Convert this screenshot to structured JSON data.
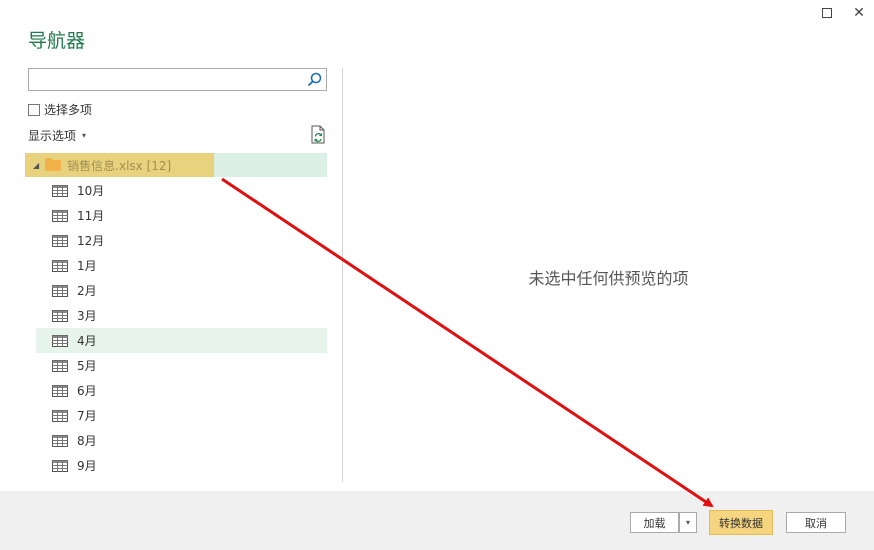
{
  "dialog": {
    "title": "导航器",
    "window_controls": {
      "maximize_icon": "square-icon",
      "close_glyph": "✕"
    }
  },
  "search": {
    "value": "",
    "placeholder": ""
  },
  "options": {
    "multi_select_label": "选择多项",
    "multi_select_checked": false,
    "display_options_label": "显示选项",
    "display_options_caret": "▾"
  },
  "tree": {
    "root": {
      "label": "销售信息.xlsx [12]",
      "expanded_glyph": "◢"
    },
    "items": [
      {
        "label": "10月",
        "selected": false
      },
      {
        "label": "11月",
        "selected": false
      },
      {
        "label": "12月",
        "selected": false
      },
      {
        "label": "1月",
        "selected": false
      },
      {
        "label": "2月",
        "selected": false
      },
      {
        "label": "3月",
        "selected": false
      },
      {
        "label": "4月",
        "selected": true
      },
      {
        "label": "5月",
        "selected": false
      },
      {
        "label": "6月",
        "selected": false
      },
      {
        "label": "7月",
        "selected": false
      },
      {
        "label": "8月",
        "selected": false
      },
      {
        "label": "9月",
        "selected": false
      }
    ]
  },
  "preview": {
    "empty_message": "未选中任何供预览的项"
  },
  "footer": {
    "load_label": "加载",
    "load_dropdown_glyph": "▾",
    "transform_label": "转换数据",
    "cancel_label": "取消"
  },
  "colors": {
    "accent_green": "#1f7a4c",
    "highlight_yellow": "#e8d27e",
    "selection_green": "#dcefe4",
    "arrow_red": "#e01010"
  }
}
